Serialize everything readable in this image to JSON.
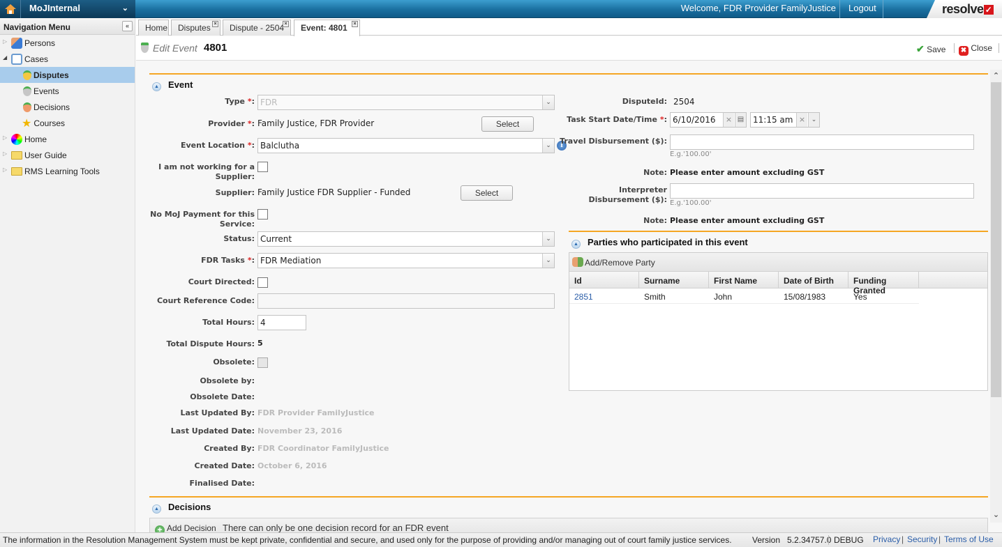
{
  "topbar": {
    "app_name": "MoJInternal",
    "welcome": "Welcome, FDR Provider FamilyJustice",
    "logout": "Logout",
    "logo": "resolve"
  },
  "sidebar": {
    "title": "Navigation Menu",
    "items": [
      {
        "label": "Persons",
        "icon": "persons-icon",
        "level": 0
      },
      {
        "label": "Cases",
        "icon": "cases-icon",
        "level": 0
      },
      {
        "label": "Disputes",
        "icon": "medal-gold-icon",
        "level": 1,
        "selected": true
      },
      {
        "label": "Events",
        "icon": "medal-grey-icon",
        "level": 1
      },
      {
        "label": "Decisions",
        "icon": "medal-orange-icon",
        "level": 1
      },
      {
        "label": "Courses",
        "icon": "star-icon",
        "level": 1
      },
      {
        "label": "Home",
        "icon": "globe-icon",
        "level": 0
      },
      {
        "label": "User Guide",
        "icon": "folder-icon",
        "level": 0
      },
      {
        "label": "RMS Learning Tools",
        "icon": "folder-icon",
        "level": 0
      }
    ]
  },
  "tabs": [
    {
      "label": "Home",
      "closable": false
    },
    {
      "label": "Disputes",
      "closable": true
    },
    {
      "label": "Dispute - 2504",
      "closable": true
    },
    {
      "label": "Event: 4801",
      "closable": true,
      "active": true
    }
  ],
  "titlebar": {
    "prefix": "Edit Event",
    "id": "4801",
    "save": "Save",
    "close": "Close"
  },
  "event": {
    "section_title": "Event",
    "type": {
      "label": "Type",
      "value": "FDR"
    },
    "provider": {
      "label": "Provider",
      "value": "Family Justice, FDR Provider",
      "button": "Select"
    },
    "location": {
      "label": "Event Location",
      "value": "Balclutha"
    },
    "not_supplier": {
      "label_line1": "I am not working for a",
      "label_line2": "Supplier:",
      "checked": false
    },
    "supplier": {
      "label": "Supplier:",
      "value": "Family Justice FDR Supplier - Funded",
      "button": "Select"
    },
    "no_moj_payment": {
      "label_line1": "No MoJ Payment for this",
      "label_line2": "Service:",
      "checked": false
    },
    "status": {
      "label": "Status:",
      "value": "Current"
    },
    "fdr_tasks": {
      "label": "FDR Tasks",
      "value": "FDR Mediation"
    },
    "court_directed": {
      "label": "Court Directed:",
      "checked": false
    },
    "court_ref": {
      "label": "Court Reference Code:",
      "value": ""
    },
    "total_hours": {
      "label": "Total Hours:",
      "value": "4"
    },
    "total_dispute_hours": {
      "label": "Total Dispute Hours:",
      "value": "5"
    },
    "obsolete": {
      "label": "Obsolete:",
      "checked": false
    },
    "obsolete_by": {
      "label": "Obsolete by:",
      "value": ""
    },
    "obsolete_date": {
      "label": "Obsolete Date:",
      "value": ""
    },
    "last_updated_by": {
      "label": "Last Updated By:",
      "value": "FDR Provider FamilyJustice"
    },
    "last_updated_date": {
      "label": "Last Updated Date:",
      "value": "November 23, 2016"
    },
    "created_by": {
      "label": "Created By:",
      "value": "FDR Coordinator FamilyJustice"
    },
    "created_date": {
      "label": "Created Date:",
      "value": "October 6, 2016"
    },
    "finalised_date": {
      "label": "Finalised Date:",
      "value": ""
    },
    "dispute_id": {
      "label": "DisputeId:",
      "value": "2504"
    },
    "task_start": {
      "label": "Task Start Date/Time",
      "date": "6/10/2016",
      "time": "11:15 am"
    },
    "travel": {
      "label": "Travel Disbursement ($):",
      "value": "",
      "hint": "E.g.'100.00'"
    },
    "note1": {
      "label": "Note:",
      "value": "Please enter amount excluding GST"
    },
    "interpreter": {
      "label_line1": "Interpreter",
      "label_line2": "Disbursement ($):",
      "value": "",
      "hint": "E.g.'100.00'"
    },
    "note2": {
      "label": "Note:",
      "value": "Please enter amount excluding GST"
    }
  },
  "parties": {
    "section_title": "Parties who participated in this event",
    "toolbar_button": "Add/Remove Party",
    "columns": [
      "Id",
      "Surname",
      "First Name",
      "Date of Birth",
      "Funding Granted"
    ],
    "rows": [
      [
        "2851",
        "Smith",
        "John",
        "15/08/1983",
        "Yes"
      ]
    ]
  },
  "decisions": {
    "section_title": "Decisions",
    "add_button": "Add Decision",
    "message": "There can only be one decision record for an FDR event"
  },
  "footer": {
    "notice": "The information in the Resolution Management System must be kept private, confidential and secure, and used only for the purpose of providing and/or managing out of court family justice services.",
    "version_label": "Version",
    "version": "5.2.34757.0",
    "mode": "DEBUG",
    "links": [
      "Privacy",
      "Security",
      "Terms of Use"
    ]
  }
}
